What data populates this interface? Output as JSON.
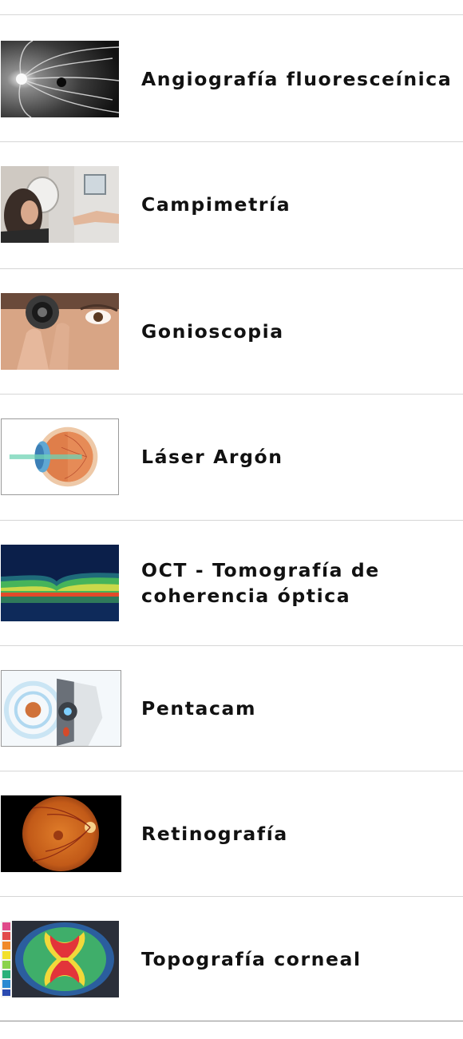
{
  "items": [
    {
      "label": "Angiografía fluoresceínica",
      "icon": "fluorescein-angiography-photo"
    },
    {
      "label": "Campimetría",
      "icon": "visual-field-test-photo"
    },
    {
      "label": "Gonioscopia",
      "icon": "gonioscopy-lens-photo"
    },
    {
      "label": "Láser Argón",
      "icon": "argon-laser-eye-diagram"
    },
    {
      "label": "OCT - Tomografía de coherencia óptica",
      "icon": "oct-scan-image"
    },
    {
      "label": "Pentacam",
      "icon": "pentacam-device-illustration"
    },
    {
      "label": "Retinografía",
      "icon": "fundus-retina-photo"
    },
    {
      "label": "Topografía corneal",
      "icon": "corneal-topography-map"
    }
  ],
  "colors": {
    "divider": "#d6d6d6",
    "last_divider": "#8f8f8f",
    "text": "#111111"
  }
}
